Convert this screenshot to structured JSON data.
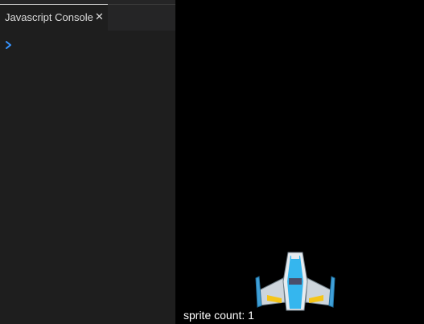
{
  "console": {
    "tab_title": "Javascript Console",
    "close_glyph": "✕",
    "prompt_icon": "chevron-right-icon",
    "input_value": "",
    "prompt_color": "#3794ff"
  },
  "game": {
    "sprite_count_text": "sprite count: 1",
    "sprite_icon": "spaceship-icon"
  }
}
